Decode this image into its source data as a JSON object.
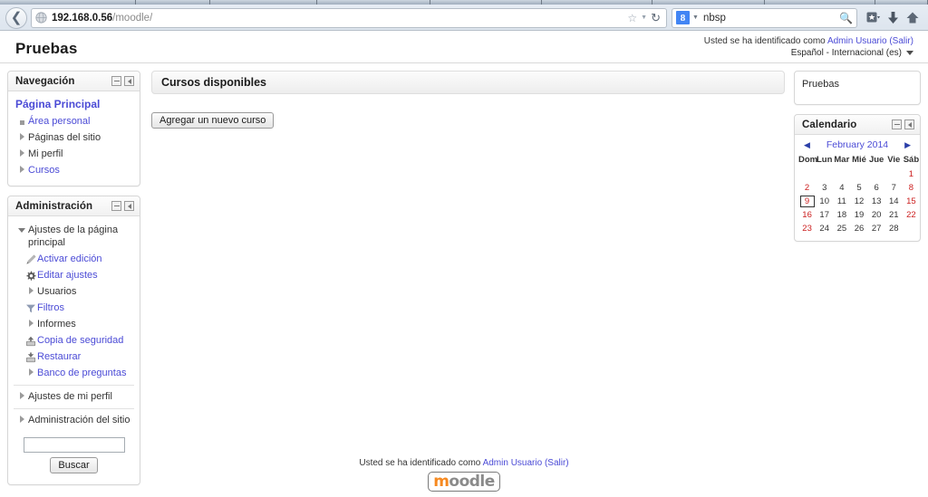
{
  "browser": {
    "back_icon": "back-arrow-icon",
    "url": {
      "host": "192.168.0.56",
      "path": "/moodle/"
    },
    "url_full": "192.168.0.56/moodle/",
    "bookmark_icon": "star-icon",
    "reload_icon": "reload-icon",
    "search": {
      "engine_badge": "8",
      "engine_name": "google-search-engine",
      "value": "nbsp",
      "magnify_icon": "magnifier-icon"
    },
    "toolbar_buttons": [
      {
        "name": "bookmarks-menu-button",
        "glyph": "★"
      },
      {
        "name": "downloads-button",
        "glyph": "↓"
      },
      {
        "name": "home-button",
        "glyph": "⌂"
      }
    ]
  },
  "header": {
    "site_title": "Pruebas",
    "login_prefix": "Usted se ha identificado como ",
    "user_name": "Admin Usuario",
    "logout_label": "(Salir)",
    "language": "Español - Internacional (es)"
  },
  "navigation_block": {
    "title": "Navegación",
    "collapse_icon": "minus-icon",
    "dock_icon": "dock-left-icon",
    "home_label": "Página Principal",
    "items": [
      {
        "label": "Área personal",
        "icon": "square-bullet-icon",
        "link": true
      },
      {
        "label": "Páginas del sitio",
        "icon": "triangle-right-icon",
        "link": false
      },
      {
        "label": "Mi perfil",
        "icon": "triangle-right-icon",
        "link": false
      },
      {
        "label": "Cursos",
        "icon": "triangle-right-icon",
        "link": true
      }
    ]
  },
  "administration_block": {
    "title": "Administración",
    "collapse_icon": "minus-icon",
    "dock_icon": "dock-left-icon",
    "root_label": "Ajustes de la página principal",
    "root_icon": "triangle-down-icon",
    "items": [
      {
        "label": "Activar edición",
        "icon": "pencil-icon",
        "link": true
      },
      {
        "label": "Editar ajustes",
        "icon": "gear-icon",
        "link": true
      },
      {
        "label": "Usuarios",
        "icon": "triangle-right-icon",
        "link": false
      },
      {
        "label": "Filtros",
        "icon": "funnel-icon",
        "link": true
      },
      {
        "label": "Informes",
        "icon": "triangle-right-icon",
        "link": false
      },
      {
        "label": "Copia de seguridad",
        "icon": "backup-upload-icon",
        "link": true
      },
      {
        "label": "Restaurar",
        "icon": "restore-download-icon",
        "link": true
      },
      {
        "label": "Banco de preguntas",
        "icon": "triangle-right-icon",
        "link": true
      }
    ],
    "profile_settings_label": "Ajustes de mi perfil",
    "profile_settings_icon": "triangle-right-icon",
    "site_admin_label": "Administración del sitio",
    "site_admin_icon": "triangle-right-icon",
    "search_value": "",
    "search_button_label": "Buscar"
  },
  "main": {
    "courses_heading": "Cursos disponibles",
    "add_course_button": "Agregar un nuevo curso"
  },
  "right_column": {
    "pruebas_block": {
      "text": "Pruebas"
    },
    "calendar": {
      "title": "Calendario",
      "collapse_icon": "minus-icon",
      "dock_icon": "dock-left-icon",
      "prev_icon": "triangle-left-icon",
      "next_icon": "triangle-right-icon",
      "month_label": "February 2014",
      "weekday_headers": [
        "Dom",
        "Lun",
        "Mar",
        "Mié",
        "Jue",
        "Vie",
        "Sáb"
      ],
      "weeks": [
        [
          "",
          "",
          "",
          "",
          "",
          "",
          "1"
        ],
        [
          "2",
          "3",
          "4",
          "5",
          "6",
          "7",
          "8"
        ],
        [
          "9",
          "10",
          "11",
          "12",
          "13",
          "14",
          "15"
        ],
        [
          "16",
          "17",
          "18",
          "19",
          "20",
          "21",
          "22"
        ],
        [
          "23",
          "24",
          "25",
          "26",
          "27",
          "28",
          ""
        ]
      ],
      "today": "9",
      "weekend_columns": [
        0,
        6
      ]
    }
  },
  "footer": {
    "login_prefix": "Usted se ha identificado como ",
    "user_name": "Admin Usuario",
    "logout_label": "(Salir)",
    "logo_first": "m",
    "logo_rest": "oodle"
  },
  "colors": {
    "link": "#4b4bd6",
    "weekend": "#cc2020",
    "moodle_orange": "#f68920",
    "chrome_bg": "#e8eef5"
  }
}
